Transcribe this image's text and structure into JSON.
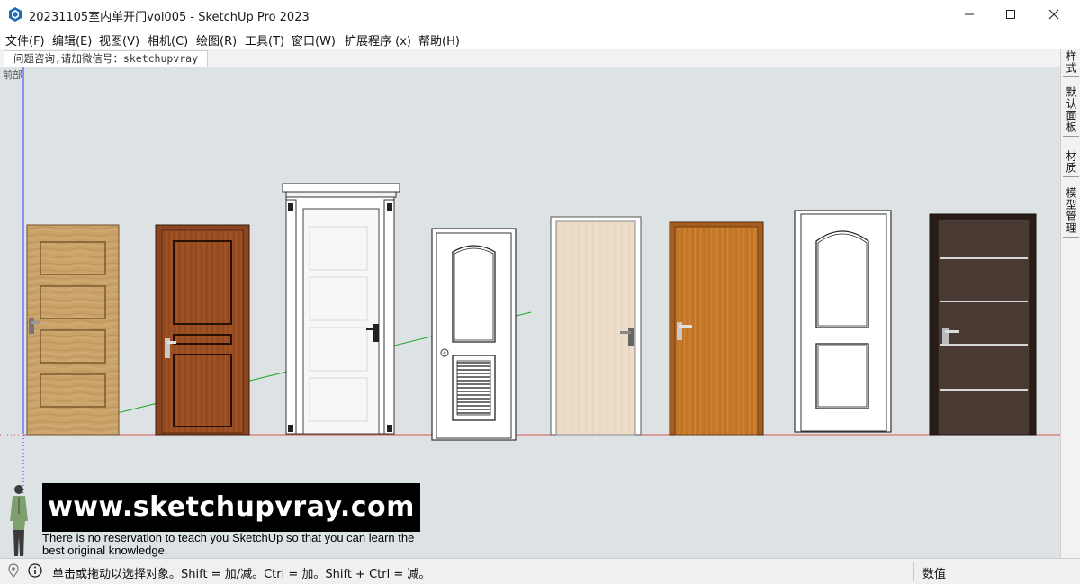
{
  "window": {
    "title": "20231105室内单开门vol005 - SketchUp Pro 2023",
    "minimize_icon": "minimize-icon",
    "maximize_icon": "maximize-icon",
    "close_icon": "close-icon"
  },
  "menu": [
    "文件(F)",
    "编辑(E)",
    "视图(V)",
    "相机(C)",
    "绘图(R)",
    "工具(T)",
    "窗口(W)",
    "扩展程序 (x)",
    "帮助(H)"
  ],
  "scene_tab": "问题咨询,请加微信号：sketchupvray",
  "viewport": {
    "view_label": "前部",
    "colors": {
      "sky": "#dde3e5",
      "red_axis": "#d9534f",
      "green_axis": "#22a522",
      "blue_axis": "#3a3aff"
    },
    "banner_text": "www.sketchupvray.com",
    "tagline": "There is no reservation to teach you SketchUp so that you can learn the best original knowledge."
  },
  "tray_tabs": [
    "样式",
    "默认面板",
    "材质",
    "模型管理"
  ],
  "status": {
    "message": "单击或拖动以选择对象。Shift = 加/减。Ctrl = 加。Shift + Ctrl = 减。",
    "measurements_label": "数值",
    "measurements_value": ""
  }
}
